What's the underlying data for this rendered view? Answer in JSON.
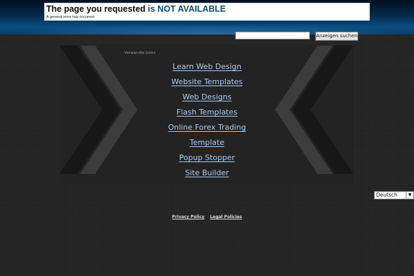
{
  "header": {
    "title_part1": "The page you requested ",
    "title_part2": "is NOT AVAILABLE",
    "subtitle": "A general error has occurred"
  },
  "search": {
    "value": "",
    "placeholder": "",
    "button_label": "Anzeigen suchen"
  },
  "related": {
    "label": "Verwandte Links",
    "links": [
      "Learn Web Design",
      "Website Templates",
      "Web Designs",
      "Flash Templates",
      "Online Forex Trading",
      "Template",
      "Popup Stopper",
      "Site Builder"
    ]
  },
  "language": {
    "selected": "Deutsch",
    "arrow_icon": "dropdown-arrow-icon"
  },
  "footer": {
    "privacy_label": "Privacy Policy",
    "legal_label": "Legal Policies"
  },
  "colors": {
    "background": "#262626",
    "link": "#a9cdf2",
    "title_accent": "#0f4c73",
    "header_blue": "#0b4f86"
  }
}
